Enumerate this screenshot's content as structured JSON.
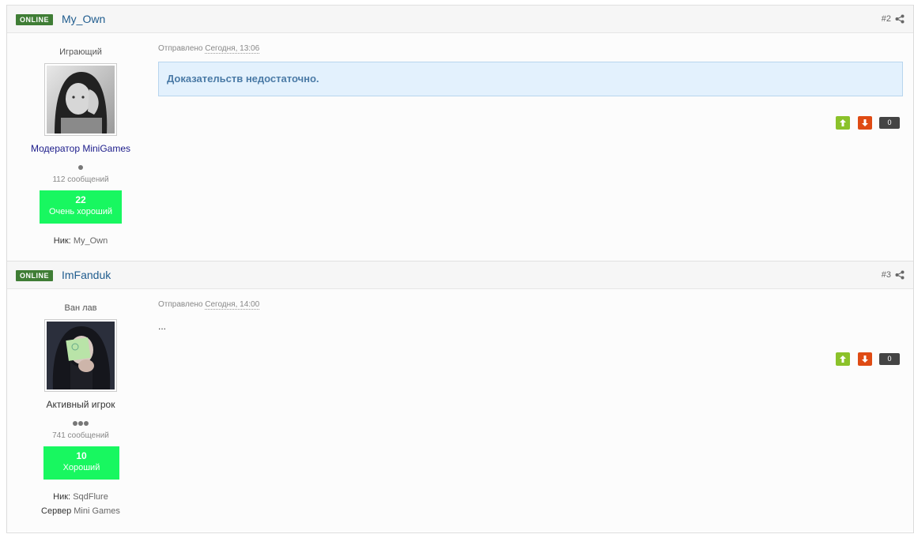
{
  "posts": [
    {
      "badge": "ONLINE",
      "username": "My_Own",
      "post_number": "#2",
      "rank_title": "Играющий",
      "group": "Модератор MiniGames",
      "group_color": "#1b1b8a",
      "pips": 1,
      "post_count": "112 сообщений",
      "reputation": "22",
      "reputation_label": "Очень хороший",
      "fields": [
        {
          "label": "Ник:",
          "value": "My_Own"
        }
      ],
      "posted_label": "Отправлено",
      "posted_date": "Сегодня, 13:06",
      "content": "Доказательств недостаточно.",
      "score": "0"
    },
    {
      "badge": "ONLINE",
      "username": "ImFanduk",
      "post_number": "#3",
      "rank_title": "Ван лав",
      "group": "Активный игрок",
      "group_color": "#333333",
      "pips": 3,
      "post_count": "741 сообщений",
      "reputation": "10",
      "reputation_label": "Хороший",
      "fields": [
        {
          "label": "Ник:",
          "value": "SqdFlure"
        },
        {
          "label": "Сервер",
          "value": "Mini Games"
        }
      ],
      "posted_label": "Отправлено",
      "posted_date": "Сегодня, 14:00",
      "content": "...",
      "score": "0"
    }
  ],
  "icons": {
    "share": "share-icon",
    "vote_up": "arrow-up-icon",
    "vote_down": "arrow-down-icon"
  },
  "colors": {
    "online_badge": "#3f7d35",
    "username": "#1f5c8e",
    "reputation_bg": "#18f760",
    "vote_up": "#8bc22a",
    "vote_down": "#df4b14",
    "quote_bg": "#e3f1fd"
  }
}
